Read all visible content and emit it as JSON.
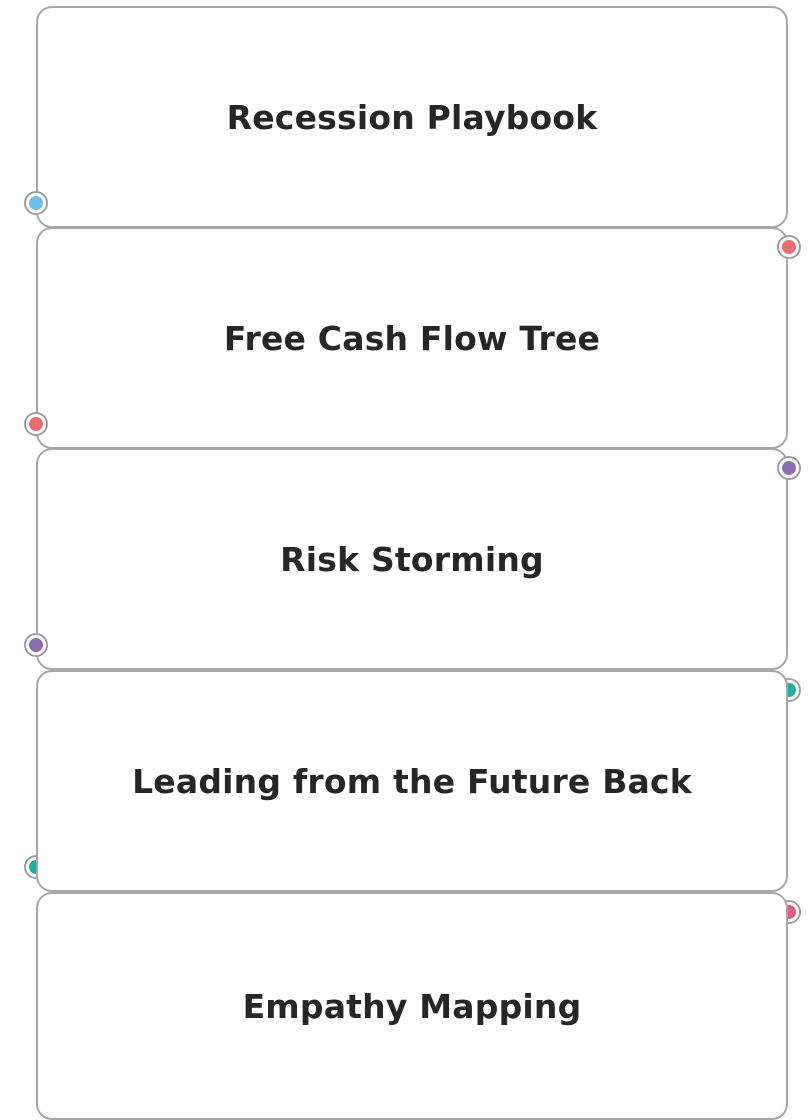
{
  "cards": [
    {
      "title": "Recession Playbook",
      "in_color": null,
      "out_color": "#6bbfe8"
    },
    {
      "title": "Free Cash Flow Tree",
      "in_color": "#ec6d6d",
      "out_color": "#ec6d6d"
    },
    {
      "title": "Risk Storming",
      "in_color": "#8a6fb5",
      "out_color": "#8a6fb5"
    },
    {
      "title": "Leading from the Future Back",
      "in_color": "#17b4a4",
      "out_color": "#17b4a4"
    },
    {
      "title": "Empathy Mapping",
      "in_color": "#e8577f",
      "out_color": null
    }
  ]
}
